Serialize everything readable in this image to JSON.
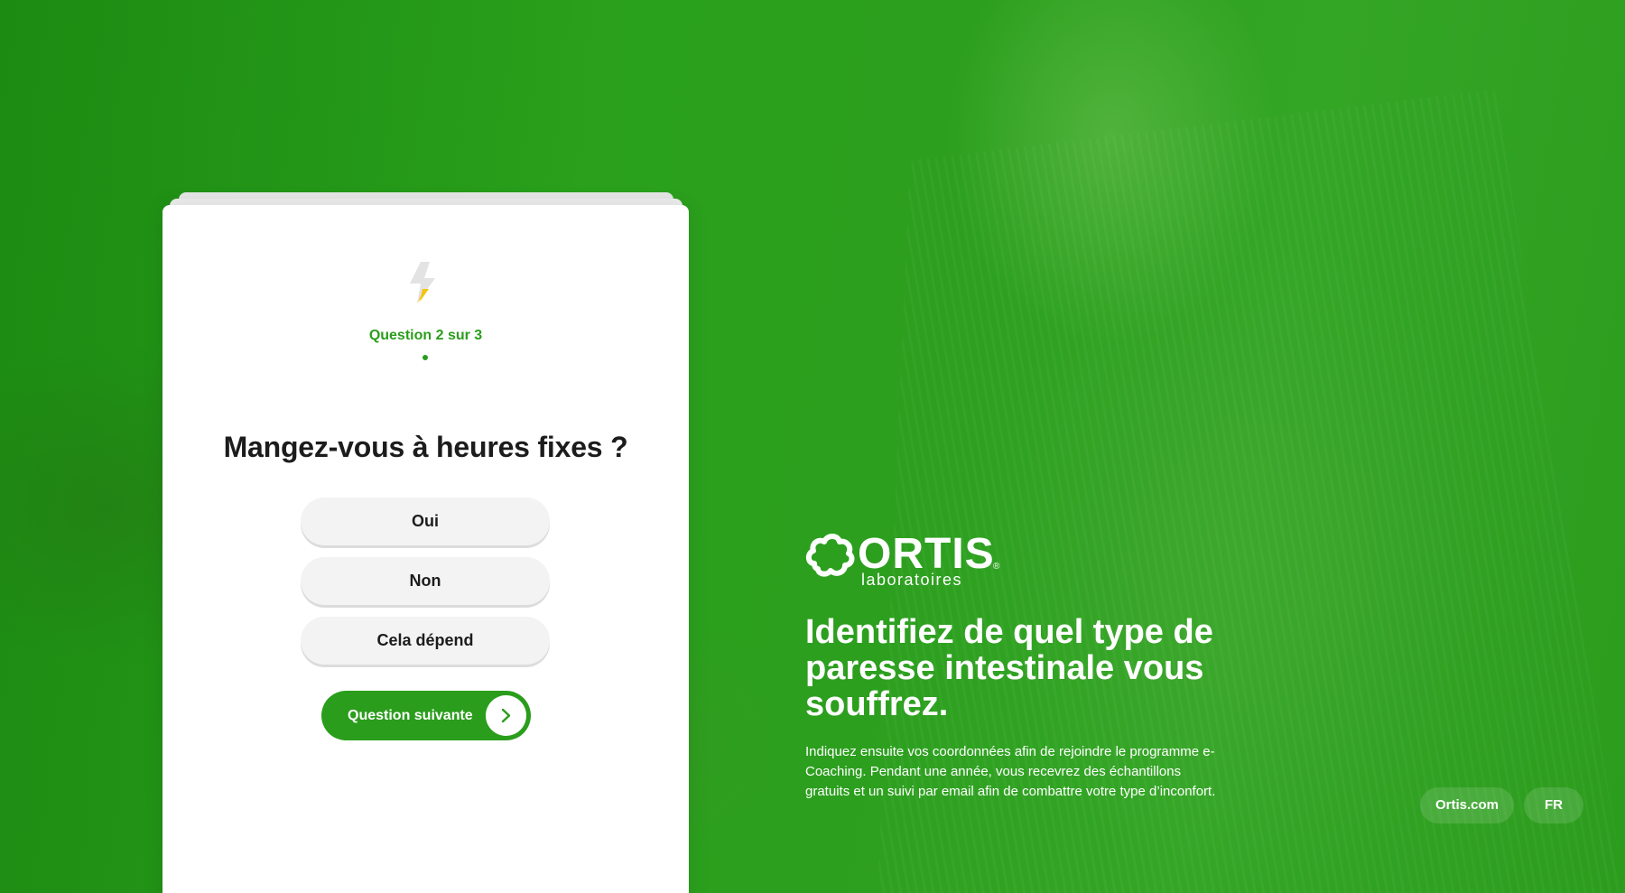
{
  "quiz": {
    "progress_label": "Question 2 sur 3",
    "question": "Mangez-vous à heures fixes ?",
    "answers": [
      {
        "label": "Oui"
      },
      {
        "label": "Non"
      },
      {
        "label": "Cela dépend"
      }
    ],
    "next_button_label": "Question suivante",
    "icon": "lightning-bolt-icon"
  },
  "brand": {
    "name": "ORTIS",
    "registered_mark": "®",
    "subtitle": "laboratoires"
  },
  "hero": {
    "headline": "Identifiez de quel type de paresse intestinale vous souffrez.",
    "description": "Indiquez ensuite vos coordonnées afin de rejoindre le programme e-Coaching. Pendant une année, vous recevrez des échantillons gratuits et un suivi par email afin de combattre votre type d’inconfort."
  },
  "footer": {
    "site_link_label": "Ortis.com",
    "language_label": "FR"
  },
  "colors": {
    "brand_green": "#2a9d1c",
    "bolt_yellow": "#f5c40f",
    "bolt_grey": "#e3e3e3"
  }
}
